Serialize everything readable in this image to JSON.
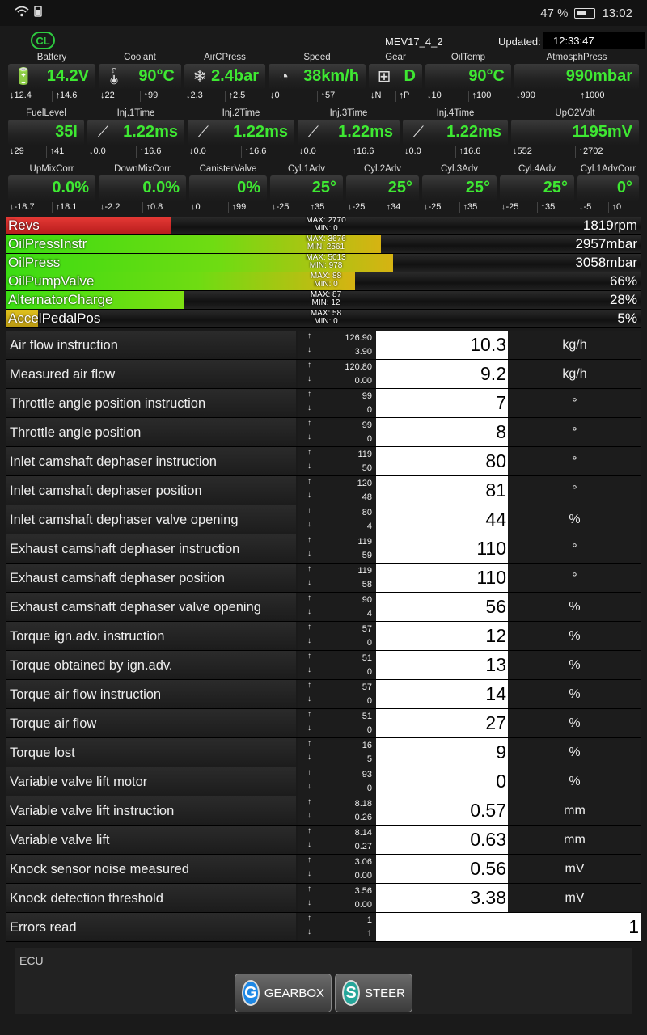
{
  "status": {
    "battery_pct": "47 %",
    "time": "13:02"
  },
  "header": {
    "cl": "CL",
    "ecu": "MEV17_4_2",
    "updated_label": "Updated:",
    "updated_time": "12:33:47"
  },
  "gauges_row1": [
    {
      "name": "Battery",
      "value": "14.2V",
      "icon": "battery-icon",
      "min": "↓12.4",
      "max": "↑14.6"
    },
    {
      "name": "Coolant",
      "value": "90°C",
      "icon": "thermometer-icon",
      "min": "↓22",
      "max": "↑99"
    },
    {
      "name": "AirCPress",
      "value": "2.4bar",
      "icon": "snowflake-icon",
      "min": "↓2.3",
      "max": "↑2.5"
    },
    {
      "name": "Speed",
      "value": "38km/h",
      "icon": "speedometer-icon",
      "min": "↓0",
      "max": "↑57"
    },
    {
      "name": "Gear",
      "value": "D",
      "icon": "gearshift-icon",
      "min": "↓N",
      "max": "↑P"
    },
    {
      "name": "OilTemp",
      "value": "90°C",
      "icon": "",
      "min": "↓10",
      "max": "↑100"
    },
    {
      "name": "AtmosphPress",
      "value": "990mbar",
      "icon": "",
      "min": "↓990",
      "max": "↑1000"
    }
  ],
  "gauges_row2": [
    {
      "name": "FuelLevel",
      "value": "35l",
      "icon": "",
      "min": "↓29",
      "max": "↑41"
    },
    {
      "name": "Inj.1Time",
      "value": "1.22ms",
      "icon": "injector-icon",
      "min": "↓0.0",
      "max": "↑16.6"
    },
    {
      "name": "Inj.2Time",
      "value": "1.22ms",
      "icon": "injector-icon",
      "min": "↓0.0",
      "max": "↑16.6"
    },
    {
      "name": "Inj.3Time",
      "value": "1.22ms",
      "icon": "injector-icon",
      "min": "↓0.0",
      "max": "↑16.6"
    },
    {
      "name": "Inj.4Time",
      "value": "1.22ms",
      "icon": "injector-icon",
      "min": "↓0.0",
      "max": "↑16.6"
    },
    {
      "name": "UpO2Volt",
      "value": "1195mV",
      "icon": "",
      "min": "↓552",
      "max": "↑2702"
    }
  ],
  "gauges_row3": [
    {
      "name": "UpMixCorr",
      "value": "0.0%",
      "min": "↓-18.7",
      "max": "↑18.1"
    },
    {
      "name": "DownMixCorr",
      "value": "0.0%",
      "min": "↓-2.2",
      "max": "↑0.8"
    },
    {
      "name": "CanisterValve",
      "value": "0%",
      "min": "↓0",
      "max": "↑99"
    },
    {
      "name": "Cyl.1Adv",
      "value": "25°",
      "min": "↓-25",
      "max": "↑35"
    },
    {
      "name": "Cyl.2Adv",
      "value": "25°",
      "min": "↓-25",
      "max": "↑34"
    },
    {
      "name": "Cyl.3Adv",
      "value": "25°",
      "min": "↓-25",
      "max": "↑35"
    },
    {
      "name": "Cyl.4Adv",
      "value": "25°",
      "min": "↓-25",
      "max": "↑35"
    },
    {
      "name": "Cyl.1AdvCorr",
      "value": "0°",
      "min": "↓-5",
      "max": "↑0"
    }
  ],
  "bars": [
    {
      "name": "Revs",
      "max": "MAX: 2770",
      "min": "MIN: 0",
      "value": "1819rpm",
      "fill": 0.26,
      "color": "red"
    },
    {
      "name": "OilPressInstr",
      "max": "MAX: 3676",
      "min": "MIN: 2561",
      "value": "2957mbar",
      "fill": 0.59,
      "color": "green-yellow"
    },
    {
      "name": "OilPress",
      "max": "MAX: 5013",
      "min": "MIN: 978",
      "value": "3058mbar",
      "fill": 0.61,
      "color": "green-yellow"
    },
    {
      "name": "OilPumpValve",
      "max": "MAX: 88",
      "min": "MIN: 0",
      "value": "66%",
      "fill": 0.55,
      "color": "green-yellow"
    },
    {
      "name": "AlternatorCharge",
      "max": "MAX: 87",
      "min": "MIN: 12",
      "value": "28%",
      "fill": 0.28,
      "color": "green"
    },
    {
      "name": "AccelPedalPos",
      "max": "MAX: 58",
      "min": "MIN: 0",
      "value": "5%",
      "fill": 0.05,
      "color": "yellow"
    }
  ],
  "rows": [
    {
      "name": "Air flow instruction",
      "max": "126.90",
      "min": "3.90",
      "value": "10.3",
      "unit": "kg/h"
    },
    {
      "name": "Measured air flow",
      "max": "120.80",
      "min": "0.00",
      "value": "9.2",
      "unit": "kg/h"
    },
    {
      "name": "Throttle angle position instruction",
      "max": "99",
      "min": "0",
      "value": "7",
      "unit": "°"
    },
    {
      "name": "Throttle angle position",
      "max": "99",
      "min": "0",
      "value": "8",
      "unit": "°"
    },
    {
      "name": "Inlet camshaft dephaser instruction",
      "max": "119",
      "min": "50",
      "value": "80",
      "unit": "°"
    },
    {
      "name": "Inlet camshaft dephaser position",
      "max": "120",
      "min": "48",
      "value": "81",
      "unit": "°"
    },
    {
      "name": "Inlet camshaft dephaser valve opening",
      "max": "80",
      "min": "4",
      "value": "44",
      "unit": "%"
    },
    {
      "name": "Exhaust camshaft dephaser instruction",
      "max": "119",
      "min": "59",
      "value": "110",
      "unit": "°"
    },
    {
      "name": "Exhaust camshaft dephaser position",
      "max": "119",
      "min": "58",
      "value": "110",
      "unit": "°"
    },
    {
      "name": "Exhaust camshaft dephaser valve opening",
      "max": "90",
      "min": "4",
      "value": "56",
      "unit": "%"
    },
    {
      "name": "Torque ign.adv. instruction",
      "max": "57",
      "min": "0",
      "value": "12",
      "unit": "%"
    },
    {
      "name": "Torque obtained by ign.adv.",
      "max": "51",
      "min": "0",
      "value": "13",
      "unit": "%"
    },
    {
      "name": "Torque air flow instruction",
      "max": "57",
      "min": "0",
      "value": "14",
      "unit": "%"
    },
    {
      "name": "Torque air flow",
      "max": "51",
      "min": "0",
      "value": "27",
      "unit": "%"
    },
    {
      "name": "Torque lost",
      "max": "16",
      "min": "5",
      "value": "9",
      "unit": "%"
    },
    {
      "name": "Variable valve lift motor",
      "max": "93",
      "min": "0",
      "value": "0",
      "unit": "%"
    },
    {
      "name": "Variable valve lift instruction",
      "max": "8.18",
      "min": "0.26",
      "value": "0.57",
      "unit": "mm"
    },
    {
      "name": "Variable valve lift",
      "max": "8.14",
      "min": "0.27",
      "value": "0.63",
      "unit": "mm"
    },
    {
      "name": "Knock sensor noise measured",
      "max": "3.06",
      "min": "0.00",
      "value": "0.56",
      "unit": "mV"
    },
    {
      "name": "Knock detection threshold",
      "max": "3.56",
      "min": "0.00",
      "value": "3.38",
      "unit": "mV"
    },
    {
      "name": "Errors read",
      "max": "1",
      "min": "1",
      "value": "1",
      "unit": ""
    }
  ],
  "bottom": {
    "title": "ECU",
    "buttons": [
      {
        "letter": "G",
        "label": "GEARBOX",
        "color": "#1e88e5"
      },
      {
        "letter": "S",
        "label": "STEER",
        "color": "#26a69a"
      }
    ]
  }
}
